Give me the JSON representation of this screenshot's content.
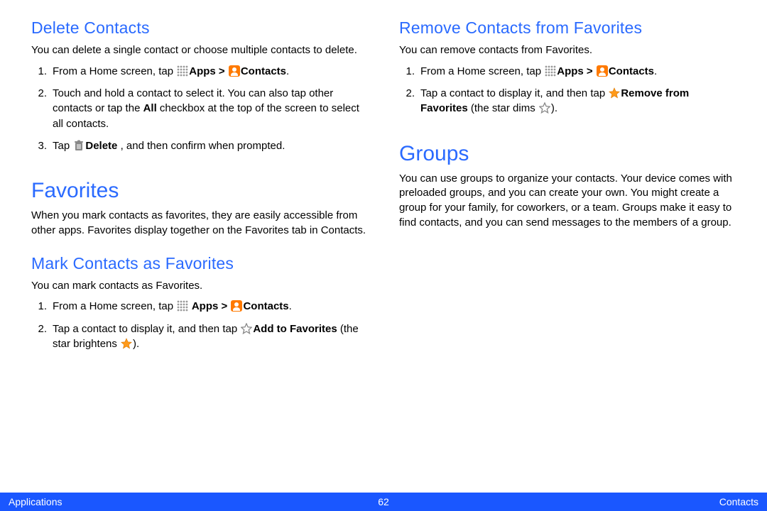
{
  "left": {
    "delete": {
      "heading": "Delete Contacts",
      "intro": "You can delete a single contact or choose multiple contacts to delete.",
      "step1_a": "From a Home screen, tap ",
      "step1_apps": "Apps > ",
      "step1_contacts": "Contacts",
      "step1_end": ".",
      "step2_a": "Touch and hold a contact to select it. You can also tap other contacts or tap the ",
      "step2_all": "All",
      "step2_b": " checkbox at the top of the screen to select all contacts.",
      "step3_a": "Tap ",
      "step3_delete": "Delete ",
      "step3_b": ", and then confirm when prompted."
    },
    "favorites": {
      "heading": "Favorites",
      "intro": "When you mark contacts as favorites, they are easily accessible from other apps. Favorites display together on the Favorites tab in Contacts."
    },
    "mark": {
      "heading": "Mark Contacts as Favorites",
      "intro": "You can mark contacts as Favorites.",
      "step1_a": "From a Home screen, tap ",
      "step1_apps": " Apps > ",
      "step1_contacts": "Contacts",
      "step1_end": ".",
      "step2_a": "Tap a contact to display it, and then tap ",
      "step2_add": "Add to Favorites",
      "step2_b": " (the star brightens ",
      "step2_end": ")."
    }
  },
  "right": {
    "remove": {
      "heading": "Remove Contacts from Favorites",
      "intro": "You can remove contacts from Favorites.",
      "step1_a": "From a Home screen, tap ",
      "step1_apps": "Apps > ",
      "step1_contacts": "Contacts",
      "step1_end": ".",
      "step2_a": "Tap a contact to display it, and then tap ",
      "step2_remove": "Remove from Favorites",
      "step2_b": " (the star dims ",
      "step2_end": ")."
    },
    "groups": {
      "heading": "Groups",
      "intro": "You can use groups to organize your contacts. Your device comes with preloaded groups, and you can create your own. You might create a group for your family, for coworkers, or a team. Groups make it easy to find contacts, and you can send messages to the members of a group."
    }
  },
  "footer": {
    "left": "Applications",
    "page": "62",
    "right": "Contacts"
  }
}
